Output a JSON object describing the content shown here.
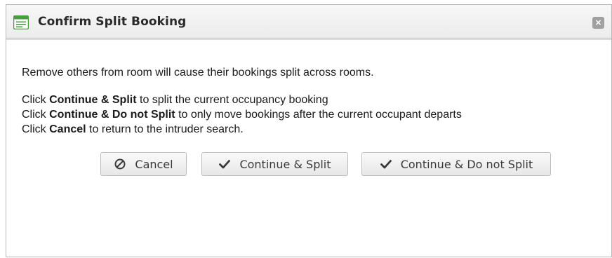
{
  "dialog": {
    "title": "Confirm Split Booking",
    "close_icon": "close-icon",
    "message": "Remove others from room will cause their bookings split across rooms.",
    "instructions": [
      {
        "prefix": "Click ",
        "bold": "Continue & Split",
        "suffix": " to split the current occupancy booking"
      },
      {
        "prefix": "Click ",
        "bold": "Continue & Do not Split",
        "suffix": " to only move bookings after the current occupant departs"
      },
      {
        "prefix": "Click ",
        "bold": "Cancel",
        "suffix": " to return to the intruder search."
      }
    ]
  },
  "buttons": {
    "cancel_label": "Cancel",
    "continue_split_label": "Continue & Split",
    "continue_no_split_label": "Continue & Do not Split"
  },
  "colors": {
    "icon_green": "#4a9d3f",
    "close_bg": "#a0a0a0"
  }
}
